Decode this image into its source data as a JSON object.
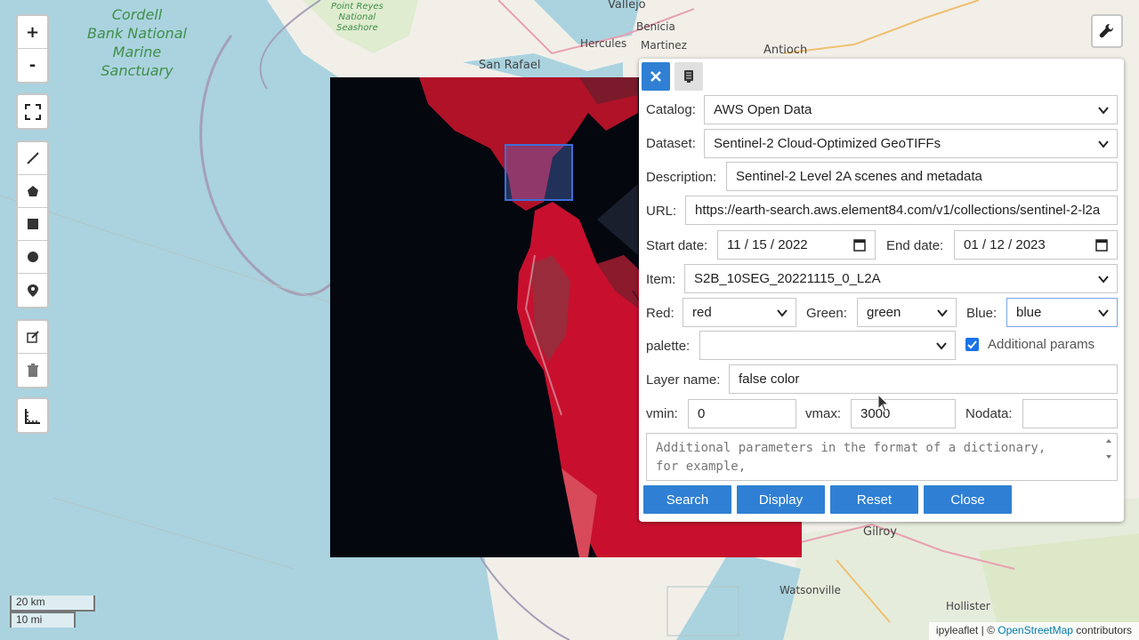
{
  "map": {
    "places": {
      "cordell": "Cordell\nBank National\nMarine\nSanctuary",
      "point_reyes": "Point Reyes\nNational\nSeashore",
      "vallejo": "Vallejo",
      "benicia": "Benicia",
      "hercules": "Hercules",
      "martinez": "Martinez",
      "antioch": "Antioch",
      "san_rafael": "San Rafael",
      "gilroy": "Gilroy",
      "watsonville": "Watsonville",
      "hollister": "Hollister"
    },
    "zoom_in": "+",
    "zoom_out": "-",
    "scale_km": "20 km",
    "scale_mi": "10 mi",
    "attribution_leaflet": "ipyleaflet",
    "attribution_sep": " | © ",
    "attribution_osm": "OpenStreetMap",
    "attribution_rest": " contributors",
    "colors": {
      "water": "#aad3df",
      "land": "#f2efe9",
      "raster_veg": "#c8102e",
      "bbox": "#3a6fd8",
      "button": "#2f80d4"
    }
  },
  "panel": {
    "catalog_label": "Catalog:",
    "catalog_value": "AWS Open Data",
    "dataset_label": "Dataset:",
    "dataset_value": "Sentinel-2 Cloud-Optimized GeoTIFFs",
    "description_label": "Description:",
    "description_value": "Sentinel-2 Level 2A scenes and metadata",
    "url_label": "URL:",
    "url_value": "https://earth-search.aws.element84.com/v1/collections/sentinel-2-l2a",
    "start_label": "Start date:",
    "start_value": "11 / 15 / 2022",
    "end_label": "End date:",
    "end_value": "01 / 12 / 2023",
    "item_label": "Item:",
    "item_value": "S2B_10SEG_20221115_0_L2A",
    "red_label": "Red:",
    "red_value": "red",
    "green_label": "Green:",
    "green_value": "green",
    "blue_label": "Blue:",
    "blue_value": "blue",
    "palette_label": "palette:",
    "palette_value": "",
    "additional_params_label": "Additional params",
    "layer_label": "Layer name:",
    "layer_value": "false color",
    "vmin_label": "vmin:",
    "vmin_value": "0",
    "vmax_label": "vmax:",
    "vmax_value": "3000",
    "nodata_label": "Nodata:",
    "nodata_value": "",
    "params_placeholder": "Additional parameters in the format of a dictionary,\nfor example,",
    "search_label": "Search",
    "display_label": "Display",
    "reset_label": "Reset",
    "close_label": "Close"
  }
}
